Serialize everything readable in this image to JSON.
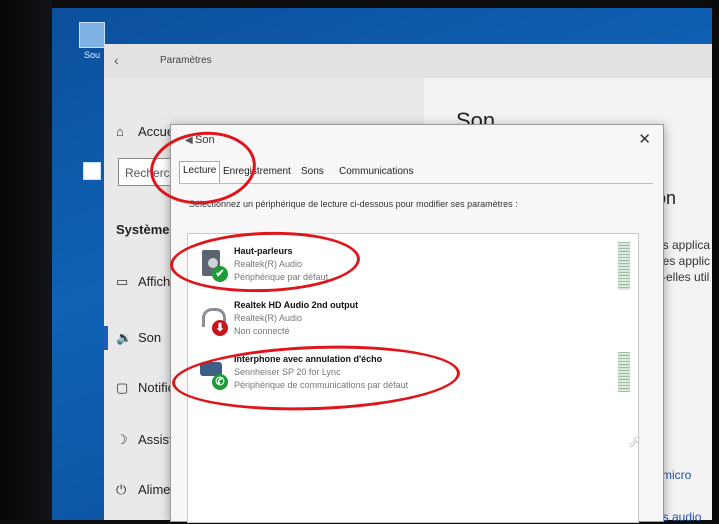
{
  "desktop": {
    "icons": [
      {
        "label": "Sou",
        "icon": "recycle-bin-icon"
      },
      {
        "label": "",
        "icon": "shortcut-icon"
      }
    ]
  },
  "settings": {
    "title": "Paramètres",
    "back_glyph": "‹",
    "nav": {
      "home": {
        "icon": "⌂",
        "label": "Accueil"
      },
      "search_placeholder": "Recherche",
      "section": "Système",
      "items": [
        {
          "icon": "▭",
          "label": "Affichage"
        },
        {
          "icon": "🔉",
          "label": "Son"
        },
        {
          "icon": "▢",
          "label": "Notifications"
        },
        {
          "icon": "☽",
          "label": "Assistant"
        },
        {
          "icon": "⏻",
          "label": "Alimentation"
        }
      ]
    },
    "right": {
      "heading": "Son",
      "subheading": "on",
      "lines": [
        "es applica",
        "des applic",
        "z-elles util"
      ],
      "letter_s": "s",
      "micro": "micro",
      "audio": "es audio"
    }
  },
  "dialog": {
    "title": "Son",
    "close": "✕",
    "tabs": [
      "Lecture",
      "Enregistrement",
      "Sons",
      "Communications"
    ],
    "instruction": "Sélectionnez un périphérique de lecture ci-dessous pour modifier ses paramètres :",
    "devices": [
      {
        "name": "Haut-parleurs",
        "driver": "Realtek(R) Audio",
        "status": "Périphérique par défaut",
        "badge": "✔",
        "badge_color": "#1e9a36",
        "icon": "speaker-icon"
      },
      {
        "name": "Realtek HD Audio 2nd output",
        "driver": "Realtek(R) Audio",
        "status": "Non connecté",
        "badge": "⬇",
        "badge_color": "#c8161d",
        "icon": "headphones-icon"
      },
      {
        "name": "Interphone avec annulation d'écho",
        "driver": "Sennheiser SP 20 for Lync",
        "status": "Périphérique de communications par défaut",
        "badge": "✆",
        "badge_color": "#1e9a36",
        "icon": "phone-icon"
      }
    ]
  },
  "colors": {
    "annotation": "#e0151b",
    "accent": "#1e5ab8"
  }
}
